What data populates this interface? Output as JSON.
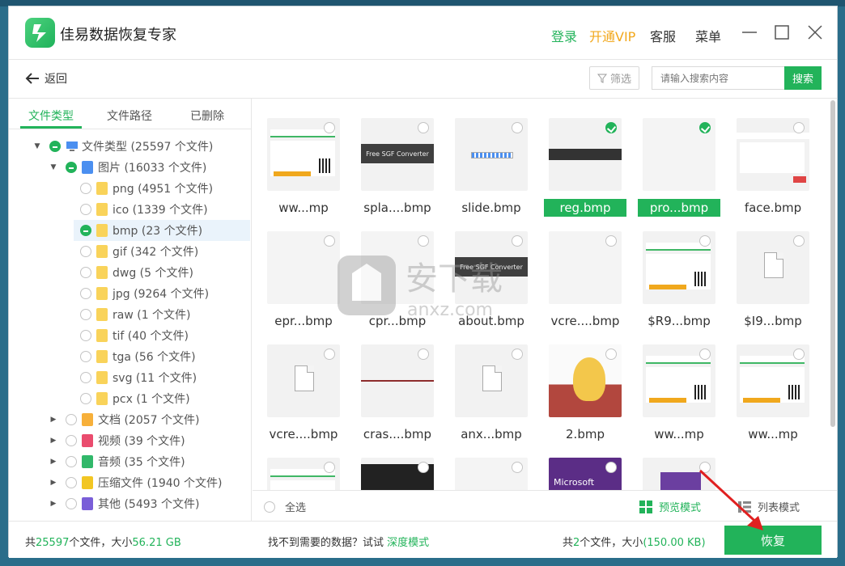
{
  "app": {
    "title": "佳易数据恢复专家"
  },
  "header": {
    "login": "登录",
    "vip": "开通VIP",
    "service": "客服",
    "menu": "菜单"
  },
  "toolbar": {
    "back": "返回",
    "filter": "筛选",
    "search_placeholder": "请输入搜索内容",
    "search": "搜索"
  },
  "tabs": [
    "文件类型",
    "文件路径",
    "已删除"
  ],
  "tree": [
    {
      "label": "文件类型 (25597 个文件)",
      "icon": "computer-icon"
    },
    {
      "label": "图片 (16033 个文件)",
      "icon": "picture-icon"
    },
    {
      "label": "png (4951 个文件)"
    },
    {
      "label": "ico (1339 个文件)"
    },
    {
      "label": "bmp (23 个文件)"
    },
    {
      "label": "gif (342 个文件)"
    },
    {
      "label": "dwg (5 个文件)"
    },
    {
      "label": "jpg (9264 个文件)"
    },
    {
      "label": "raw (1 个文件)"
    },
    {
      "label": "tif (40 个文件)"
    },
    {
      "label": "tga (56 个文件)"
    },
    {
      "label": "svg (11 个文件)"
    },
    {
      "label": "pcx (1 个文件)"
    },
    {
      "label": "文档 (2057 个文件)",
      "icon": "document-icon"
    },
    {
      "label": "视频 (39 个文件)",
      "icon": "video-icon"
    },
    {
      "label": "音频 (35 个文件)",
      "icon": "audio-icon"
    },
    {
      "label": "压缩文件 (1940 个文件)",
      "icon": "archive-icon"
    },
    {
      "label": "其他 (5493 个文件)",
      "icon": "other-icon"
    }
  ],
  "files": [
    {
      "name": "ww...mp",
      "kind": "web",
      "checked": false
    },
    {
      "name": "spla....bmp",
      "kind": "dark",
      "banner": "Free SGF Converter",
      "checked": false
    },
    {
      "name": "slide.bmp",
      "kind": "slide",
      "checked": false
    },
    {
      "name": "reg.bmp",
      "kind": "regbar",
      "checked": true
    },
    {
      "name": "pro...bmp",
      "kind": "blank",
      "checked": true
    },
    {
      "name": "face.bmp",
      "kind": "face",
      "checked": false
    },
    {
      "name": "epr...bmp",
      "kind": "blank",
      "checked": false
    },
    {
      "name": "cpr...bmp",
      "kind": "blank",
      "checked": false
    },
    {
      "name": "about.bmp",
      "kind": "dark",
      "banner": "Free SGF Converter",
      "checked": false
    },
    {
      "name": "vcre....bmp",
      "kind": "blank",
      "checked": false
    },
    {
      "name": "$R9...bmp",
      "kind": "web",
      "checked": false
    },
    {
      "name": "$I9...bmp",
      "kind": "file",
      "checked": false
    },
    {
      "name": "vcre....bmp",
      "kind": "file",
      "checked": false
    },
    {
      "name": "cras....bmp",
      "kind": "line",
      "checked": false
    },
    {
      "name": "anx...bmp",
      "kind": "file",
      "checked": false
    },
    {
      "name": "2.bmp",
      "kind": "cat",
      "checked": false
    },
    {
      "name": "ww...mp",
      "kind": "web",
      "checked": false
    },
    {
      "name": "ww...mp",
      "kind": "web",
      "checked": false
    },
    {
      "name": "",
      "kind": "web",
      "checked": false
    },
    {
      "name": "",
      "kind": "dark2",
      "checked": false
    },
    {
      "name": "",
      "kind": "blank",
      "checked": false
    },
    {
      "name": "",
      "kind": "ms",
      "text": "Microsoft",
      "checked": false
    },
    {
      "name": "",
      "kind": "ms2",
      "checked": false
    }
  ],
  "selbar": {
    "select_all": "全选",
    "preview_mode": "预览模式",
    "list_mode": "列表模式"
  },
  "status": {
    "total_prefix": "共",
    "total_count": "25597",
    "total_mid": "个文件，大小",
    "total_size": "56.21 GB",
    "hint": "找不到需要的数据？试试",
    "deep_mode": "深度模式",
    "sel_prefix": "共",
    "sel_count": "2",
    "sel_mid": "个文件，大小",
    "sel_size": "(150.00 KB)",
    "recover": "恢复"
  },
  "watermark": {
    "text": "安下载",
    "sub": "anxz.com"
  },
  "colors": {
    "accent": "#22b35a",
    "vip": "#f2a81d"
  }
}
